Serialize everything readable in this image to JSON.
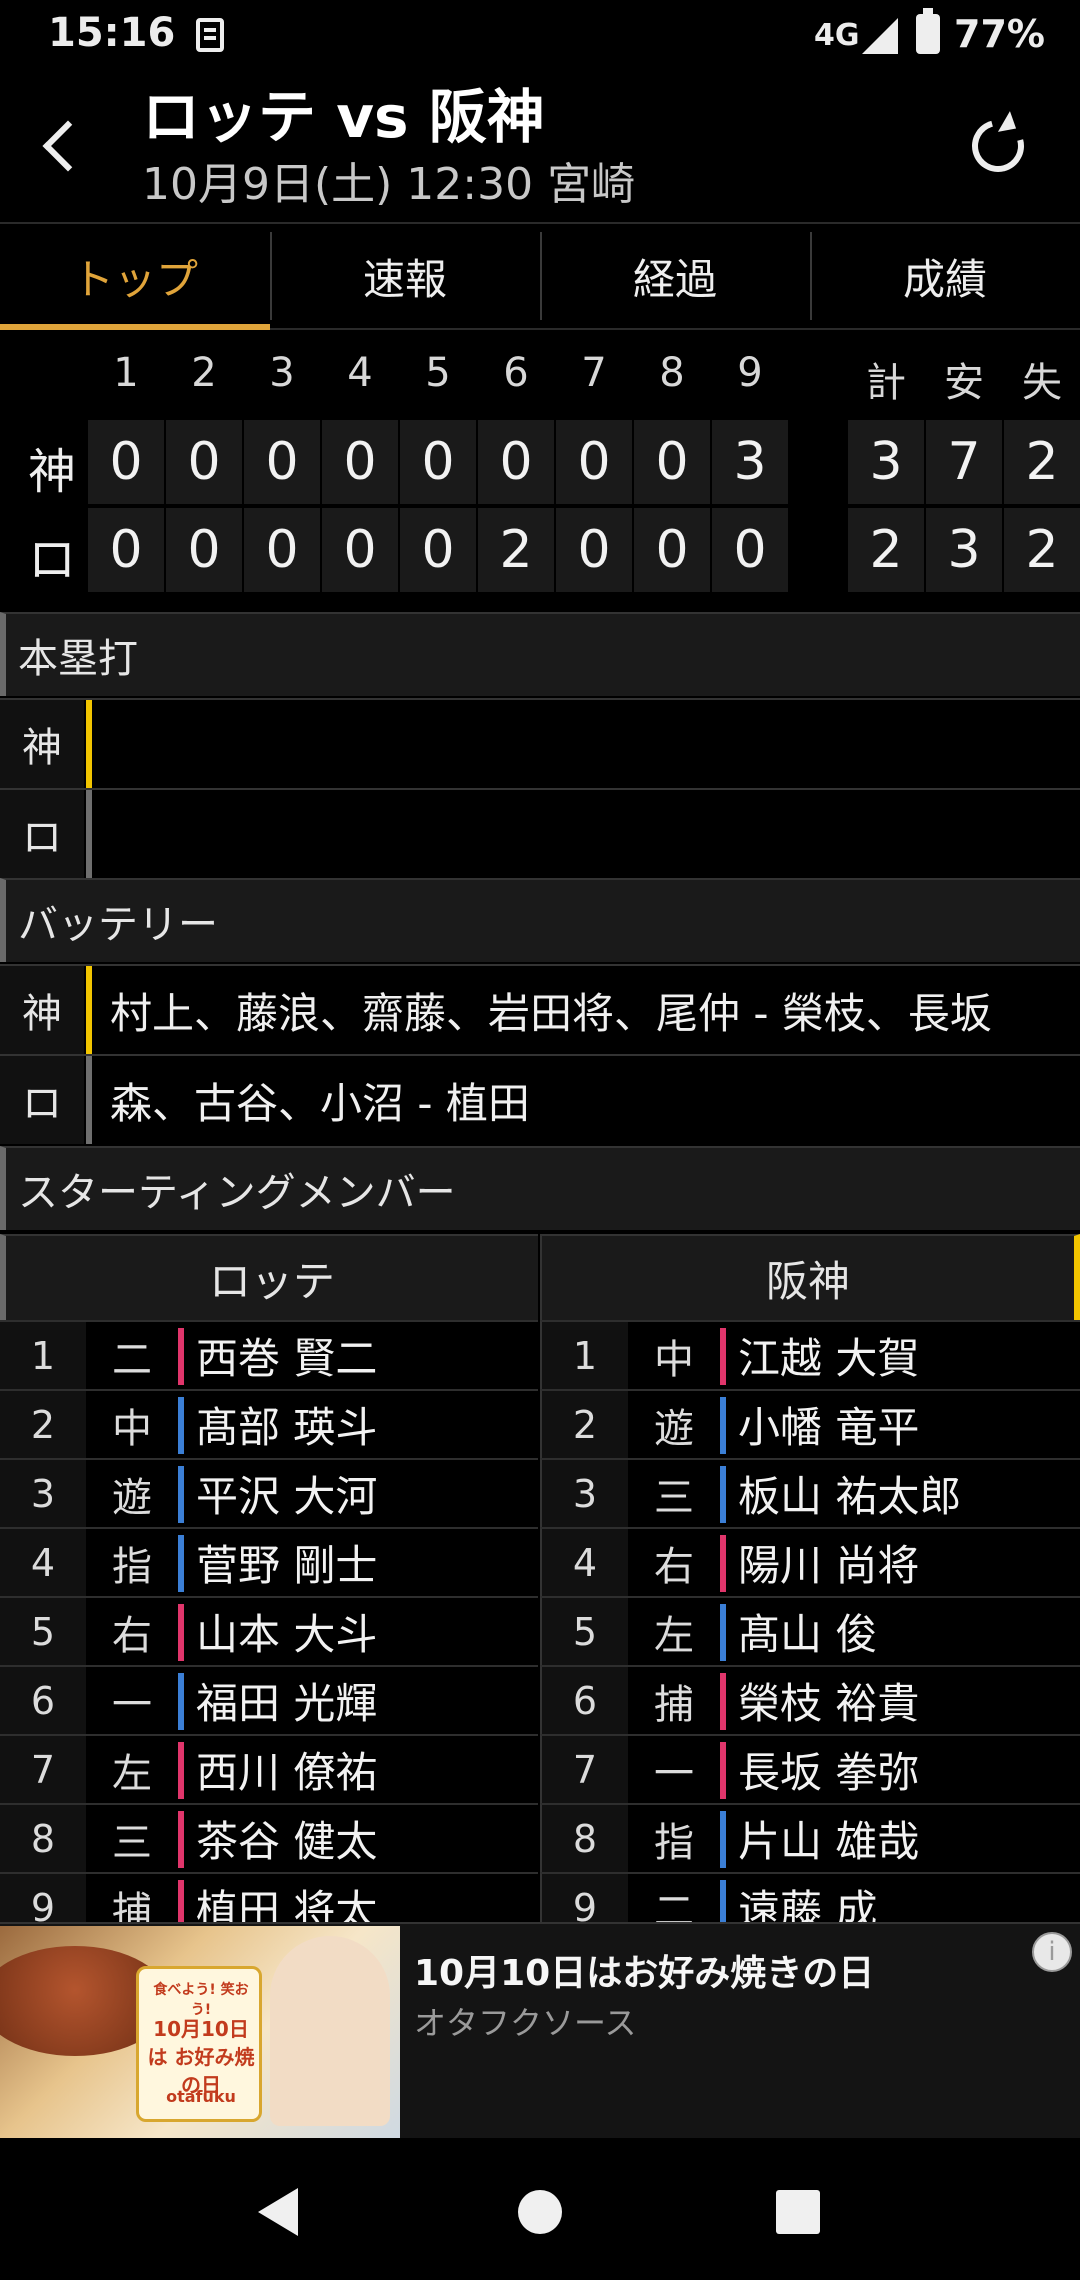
{
  "status_bar": {
    "time": "15:16",
    "network": "4G",
    "battery": "77%",
    "icons": [
      "notification-icon",
      "signal-icon",
      "battery-icon"
    ]
  },
  "header": {
    "title": "ロッテ vs 阪神",
    "subtitle": "10月9日(土) 12:30 宮崎"
  },
  "tabs": [
    {
      "label": "トップ",
      "active": true
    },
    {
      "label": "速報",
      "active": false
    },
    {
      "label": "経過",
      "active": false
    },
    {
      "label": "成績",
      "active": false
    }
  ],
  "scoreboard": {
    "innings": [
      "1",
      "2",
      "3",
      "4",
      "5",
      "6",
      "7",
      "8",
      "9"
    ],
    "totals_headers": [
      "計",
      "安",
      "失"
    ],
    "teams": [
      {
        "abbr": "神",
        "runs": [
          "0",
          "0",
          "0",
          "0",
          "0",
          "0",
          "0",
          "0",
          "3"
        ],
        "totals": [
          "3",
          "7",
          "2"
        ]
      },
      {
        "abbr": "ロ",
        "runs": [
          "0",
          "0",
          "0",
          "0",
          "0",
          "2",
          "0",
          "0",
          "0"
        ],
        "totals": [
          "2",
          "3",
          "2"
        ]
      }
    ]
  },
  "homeruns": {
    "heading": "本塁打",
    "rows": [
      {
        "team": "神",
        "text": "",
        "color": "#f2c500"
      },
      {
        "team": "ロ",
        "text": "",
        "color": "#6f6f6f"
      }
    ]
  },
  "battery": {
    "heading": "バッテリー",
    "rows": [
      {
        "team": "神",
        "text": "村上、藤浪、齋藤、岩田将、尾仲 - 榮枝、長坂",
        "color": "#f2c500"
      },
      {
        "team": "ロ",
        "text": "森、古谷、小沼 - 植田",
        "color": "#6f6f6f"
      }
    ]
  },
  "starting": {
    "heading": "スターティングメンバー",
    "team_left": "ロッテ",
    "team_right": "阪神",
    "accent_color": "#f2c500",
    "left": [
      {
        "num": "1",
        "pos": "二",
        "name": "西巻 賢二",
        "hand": "R"
      },
      {
        "num": "2",
        "pos": "中",
        "name": "髙部 瑛斗",
        "hand": "L"
      },
      {
        "num": "3",
        "pos": "遊",
        "name": "平沢 大河",
        "hand": "L"
      },
      {
        "num": "4",
        "pos": "指",
        "name": "菅野 剛士",
        "hand": "L"
      },
      {
        "num": "5",
        "pos": "右",
        "name": "山本 大斗",
        "hand": "R"
      },
      {
        "num": "6",
        "pos": "一",
        "name": "福田 光輝",
        "hand": "L"
      },
      {
        "num": "7",
        "pos": "左",
        "name": "西川 僚祐",
        "hand": "R"
      },
      {
        "num": "8",
        "pos": "三",
        "name": "茶谷 健太",
        "hand": "R"
      },
      {
        "num": "9",
        "pos": "捕",
        "name": "植田 将太",
        "hand": "R"
      }
    ],
    "right": [
      {
        "num": "1",
        "pos": "中",
        "name": "江越 大賀",
        "hand": "R"
      },
      {
        "num": "2",
        "pos": "遊",
        "name": "小幡 竜平",
        "hand": "L"
      },
      {
        "num": "3",
        "pos": "三",
        "name": "板山 祐太郎",
        "hand": "L"
      },
      {
        "num": "4",
        "pos": "右",
        "name": "陽川 尚将",
        "hand": "R"
      },
      {
        "num": "5",
        "pos": "左",
        "name": "髙山 俊",
        "hand": "L"
      },
      {
        "num": "6",
        "pos": "捕",
        "name": "榮枝 裕貴",
        "hand": "R"
      },
      {
        "num": "7",
        "pos": "一",
        "name": "長坂 拳弥",
        "hand": "R"
      },
      {
        "num": "8",
        "pos": "指",
        "name": "片山 雄哉",
        "hand": "L"
      },
      {
        "num": "9",
        "pos": "二",
        "name": "遠藤 成",
        "hand": "L"
      }
    ],
    "hand_colors": {
      "R": "#e0356b",
      "L": "#3b7fd6"
    }
  },
  "ad": {
    "title": "10月10日はお好み焼きの日",
    "sponsor": "オタフクソース",
    "badge_top": "食べよう! 笑おう!",
    "badge_main": "10月10日は お好み焼の日",
    "badge_brand": "otafuku",
    "info_icon": "ad-info-icon"
  },
  "navbar": {
    "icons": [
      "nav-back-icon",
      "nav-home-icon",
      "nav-recent-icon"
    ]
  }
}
